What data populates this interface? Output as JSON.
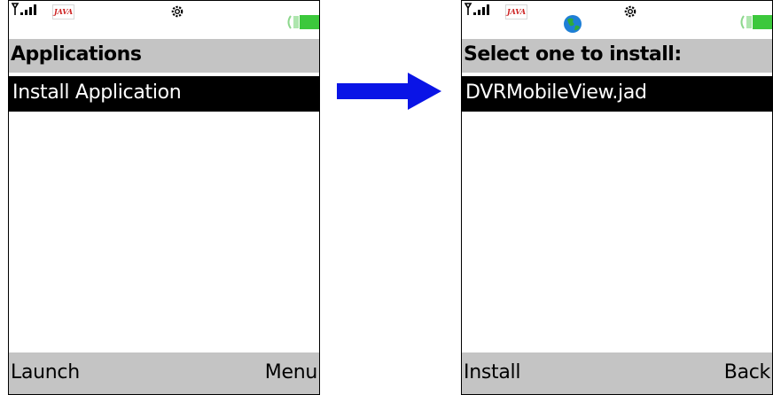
{
  "left_screen": {
    "status": {
      "java_badge": "JAVA",
      "icons": [
        "signal-icon",
        "java-icon",
        "settings-icon",
        "battery-icon"
      ]
    },
    "title": "Applications",
    "list": [
      {
        "label": "Install Application",
        "selected": true
      }
    ],
    "softkeys": {
      "left": "Launch",
      "right": "Menu"
    }
  },
  "right_screen": {
    "status": {
      "java_badge": "JAVA",
      "icons": [
        "signal-icon",
        "java-icon",
        "globe-icon",
        "settings-icon",
        "battery-icon"
      ]
    },
    "title": "Select one to install:",
    "list": [
      {
        "label": "DVRMobileView.jad",
        "selected": true
      }
    ],
    "softkeys": {
      "left": "Install",
      "right": "Back"
    }
  },
  "colors": {
    "bar_gray": "#c4c4c4",
    "selection": "#000000",
    "arrow_blue": "#0a14e6",
    "battery_green": "#3cc83c",
    "java_red": "#cc1f1f"
  }
}
